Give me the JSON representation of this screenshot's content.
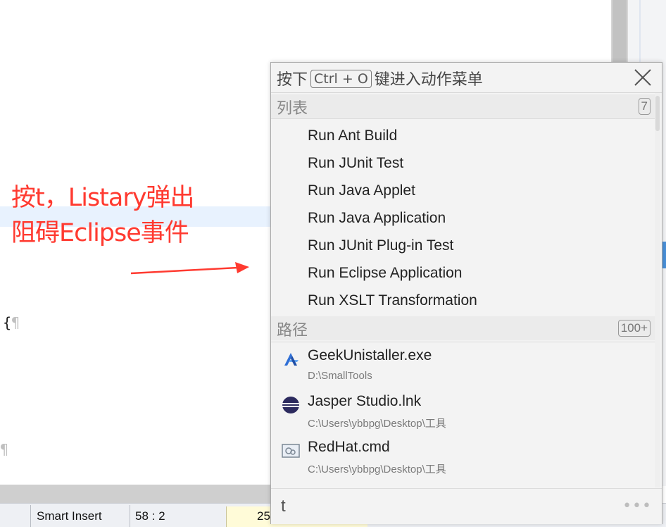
{
  "annotation": {
    "line1": "按t，Listary弹出",
    "line2": "阻碍Eclipse事件"
  },
  "editor": {
    "brace_line": "{",
    "pilcrow": "¶"
  },
  "status_bar": {
    "insert_mode": "Smart Insert",
    "position": "58 : 2",
    "memory": "25"
  },
  "popup": {
    "header_prefix": "按下",
    "shortcut": "Ctrl + O",
    "header_suffix": "键进入动作菜单",
    "list_section": {
      "title": "列表",
      "count": "7"
    },
    "list_items": [
      "Run Ant Build",
      "Run JUnit Test",
      "Run Java Applet",
      "Run Java Application",
      "Run JUnit Plug-in Test",
      "Run Eclipse Application",
      "Run XSLT Transformation"
    ],
    "path_section": {
      "title": "路径",
      "count": "100+"
    },
    "path_items": [
      {
        "name": "GeekUnistaller.exe",
        "path": "D:\\SmallTools",
        "icon": "app-icon"
      },
      {
        "name": "Jasper Studio.lnk",
        "path": "C:\\Users\\ybbpg\\Desktop\\工具",
        "icon": "eclipse-icon"
      },
      {
        "name": "RedHat.cmd",
        "path": "C:\\Users\\ybbpg\\Desktop\\工具",
        "icon": "cmd-icon"
      }
    ],
    "search_value": "t",
    "more_label": "•••"
  },
  "colors": {
    "annotation": "#ff3a30",
    "popup_bg": "#f3f3f3",
    "section_bg": "#ebebeb",
    "status_memory_bg": "#fffbd8",
    "eclipse_icon": "#2c2a5e"
  }
}
